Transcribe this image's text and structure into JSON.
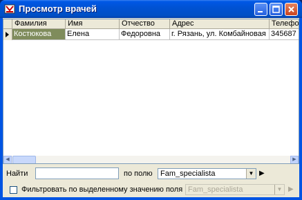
{
  "window": {
    "title": "Просмотр врачей"
  },
  "grid": {
    "columns": [
      "Фамилия",
      "Имя",
      "Отчество",
      "Адрес",
      "Телефо"
    ],
    "rows": [
      [
        "Костюкова",
        "Елена",
        "Федоровна",
        "г. Рязань, ул. Комбайновая",
        "345687"
      ]
    ]
  },
  "search": {
    "find_label": "Найти",
    "find_value": "",
    "field_label": "по полю",
    "field_value": "Fam_specialista"
  },
  "filter": {
    "checkbox_label": "Фильтровать по выделенному значению поля",
    "checked": false,
    "field_value": "Fam_specialista"
  },
  "colors": {
    "title_bar": "#0054e3",
    "selected_cell": "#7f8c5c"
  }
}
